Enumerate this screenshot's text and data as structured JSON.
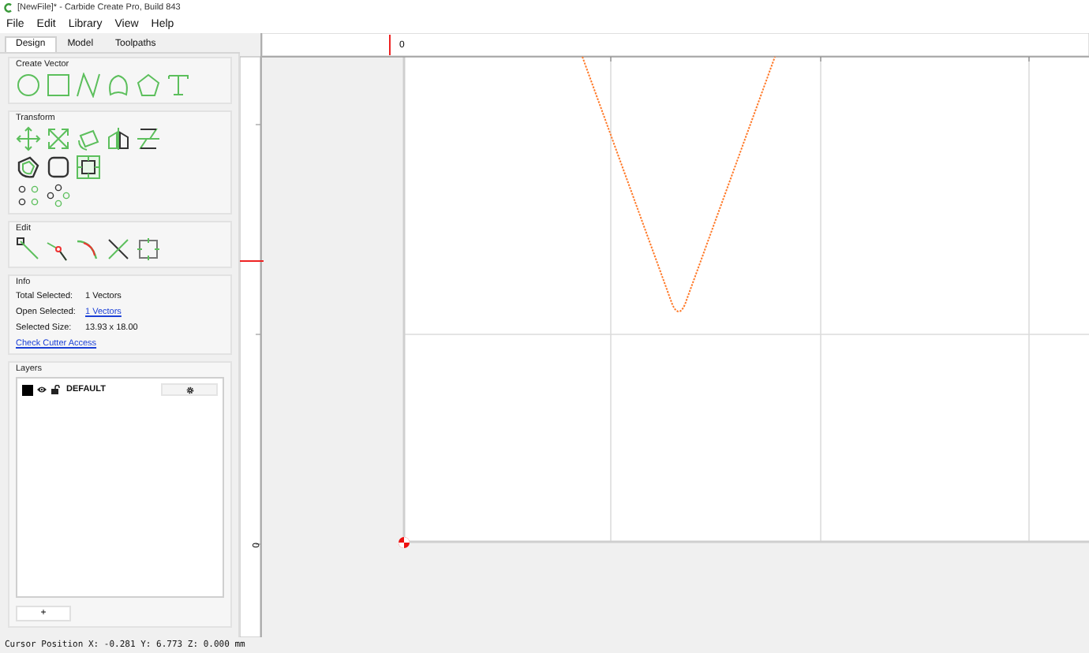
{
  "window": {
    "title": "[NewFile]* - Carbide Create Pro, Build 843"
  },
  "menu": [
    "File",
    "Edit",
    "Library",
    "View",
    "Help"
  ],
  "tabs": [
    {
      "label": "Design",
      "selected": true
    },
    {
      "label": "Model",
      "selected": false
    },
    {
      "label": "Toolpaths",
      "selected": false
    }
  ],
  "sections": [
    {
      "title": "Create Vector",
      "rows": [
        [
          {
            "kind": "circle"
          },
          {
            "kind": "rectangle"
          },
          {
            "kind": "polyline"
          },
          {
            "kind": "curve"
          },
          {
            "kind": "polygon"
          },
          {
            "kind": "text"
          }
        ]
      ]
    },
    {
      "title": "Transform",
      "rows": [
        [
          {
            "kind": "move"
          },
          {
            "kind": "scale"
          },
          {
            "kind": "rotate"
          },
          {
            "kind": "mirror"
          },
          {
            "kind": "align"
          }
        ],
        [
          {
            "kind": "offset"
          },
          {
            "kind": "fillet"
          },
          {
            "kind": "inset"
          }
        ],
        [
          {
            "kind": "dots"
          },
          {
            "kind": "pattern"
          }
        ]
      ]
    },
    {
      "title": "Edit",
      "rows": [
        [
          {
            "kind": "node"
          },
          {
            "kind": "split"
          },
          {
            "kind": "join"
          },
          {
            "kind": "trim"
          },
          {
            "kind": "boundary"
          }
        ]
      ]
    }
  ],
  "info": {
    "title": "Info",
    "rows": [
      {
        "label": "Total Selected:",
        "value": "1 Vectors",
        "kind": "text"
      },
      {
        "label": "Open Selected:",
        "value": "1 Vectors",
        "kind": "link"
      },
      {
        "label": "Selected Size:",
        "value": "13.93 x 18.00",
        "kind": "text"
      }
    ],
    "link": "Check Cutter Access"
  },
  "layers": {
    "title": "Layers",
    "items": [
      {
        "name": "DEFAULT",
        "color": "#000000",
        "visible": true,
        "locked": false
      }
    ],
    "add_button": "+"
  },
  "canvas": {
    "ruler_top_label": "0",
    "ruler_left_label": "0"
  },
  "status_bar": "Cursor Position X: -0.281 Y: 6.773 Z: 0.000 mm"
}
